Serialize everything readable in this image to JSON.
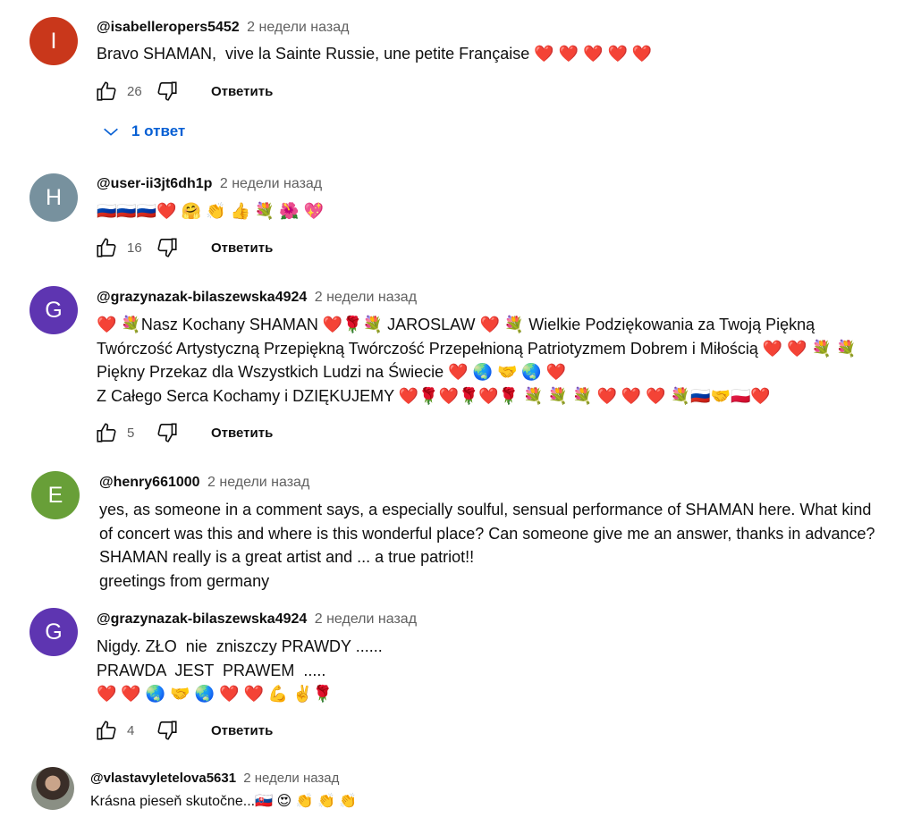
{
  "ui": {
    "reply_label": "Ответить"
  },
  "comments": [
    {
      "avatar_letter": "I",
      "avatar_color": "#c9371b",
      "author": "@isabelleropers5452",
      "time": "2 недели назад",
      "lines": [
        "Bravo SHAMAN,  vive la Sainte Russie, une petite Française ❤️ ❤️ ❤️ ❤️ ❤️"
      ],
      "likes": "26",
      "replies_label": "1 ответ"
    },
    {
      "avatar_letter": "H",
      "avatar_color": "#77919e",
      "author": "@user-ii3jt6dh1p",
      "time": "2 недели назад",
      "lines": [
        "🇷🇺🇷🇺🇷🇺❤️ 🤗 👏 👍 💐 🌺 💖"
      ],
      "likes": "16"
    },
    {
      "avatar_letter": "G",
      "avatar_color": "#5e35b1",
      "author": "@grazynazak-bilaszewska4924",
      "time": "2 недели назад",
      "lines": [
        "❤️ 💐Nasz Kochany SHAMAN ❤️🌹💐 JAROSLAW ❤️ 💐 Wielkie Podziękowania za Twoją Piękną",
        "Twórczość Artystyczną Przepiękną Twórczość Przepełnioną Patriotyzmem Dobrem i Miłością ❤️ ❤️ 💐 💐",
        "Piękny Przekaz dla Wszystkich Ludzi na Świecie ❤️ 🌏 🤝 🌏 ❤️",
        "Z Całego Serca Kochamy i DZIĘKUJEMY ❤️🌹❤️🌹❤️🌹 💐 💐 💐 ❤️ ❤️ ❤️ 💐🇷🇺🤝🇵🇱❤️"
      ],
      "likes": "5"
    },
    {
      "avatar_letter": "E",
      "avatar_color": "#689f38",
      "author": "@henry661000",
      "time": "2 недели назад",
      "lines": [
        "yes, as someone in a comment says, a especially soulful, sensual performance of SHAMAN here. What kind",
        "of concert was this and where is this wonderful place? Can someone give me an answer, thanks in advance?",
        "SHAMAN really is a great artist and ... a true patriot!!",
        "greetings from germany"
      ]
    },
    {
      "avatar_letter": "G",
      "avatar_color": "#5e35b1",
      "author": "@grazynazak-bilaszewska4924",
      "time": "2 недели назад",
      "lines": [
        "Nigdy. ZŁO  nie  zniszczy PRAWDY ......",
        "PRAWDA  JEST  PRAWEM  .....",
        "❤️ ❤️ 🌏 🤝 🌏 ❤️ ❤️ 💪 ✌️🌹"
      ],
      "likes": "4"
    },
    {
      "author": "@vlastavyletelova5631",
      "time": "2 недели назад",
      "lines": [
        "Krásna pieseň skutočne...🇸🇰 😍 👏 👏 👏"
      ]
    }
  ]
}
